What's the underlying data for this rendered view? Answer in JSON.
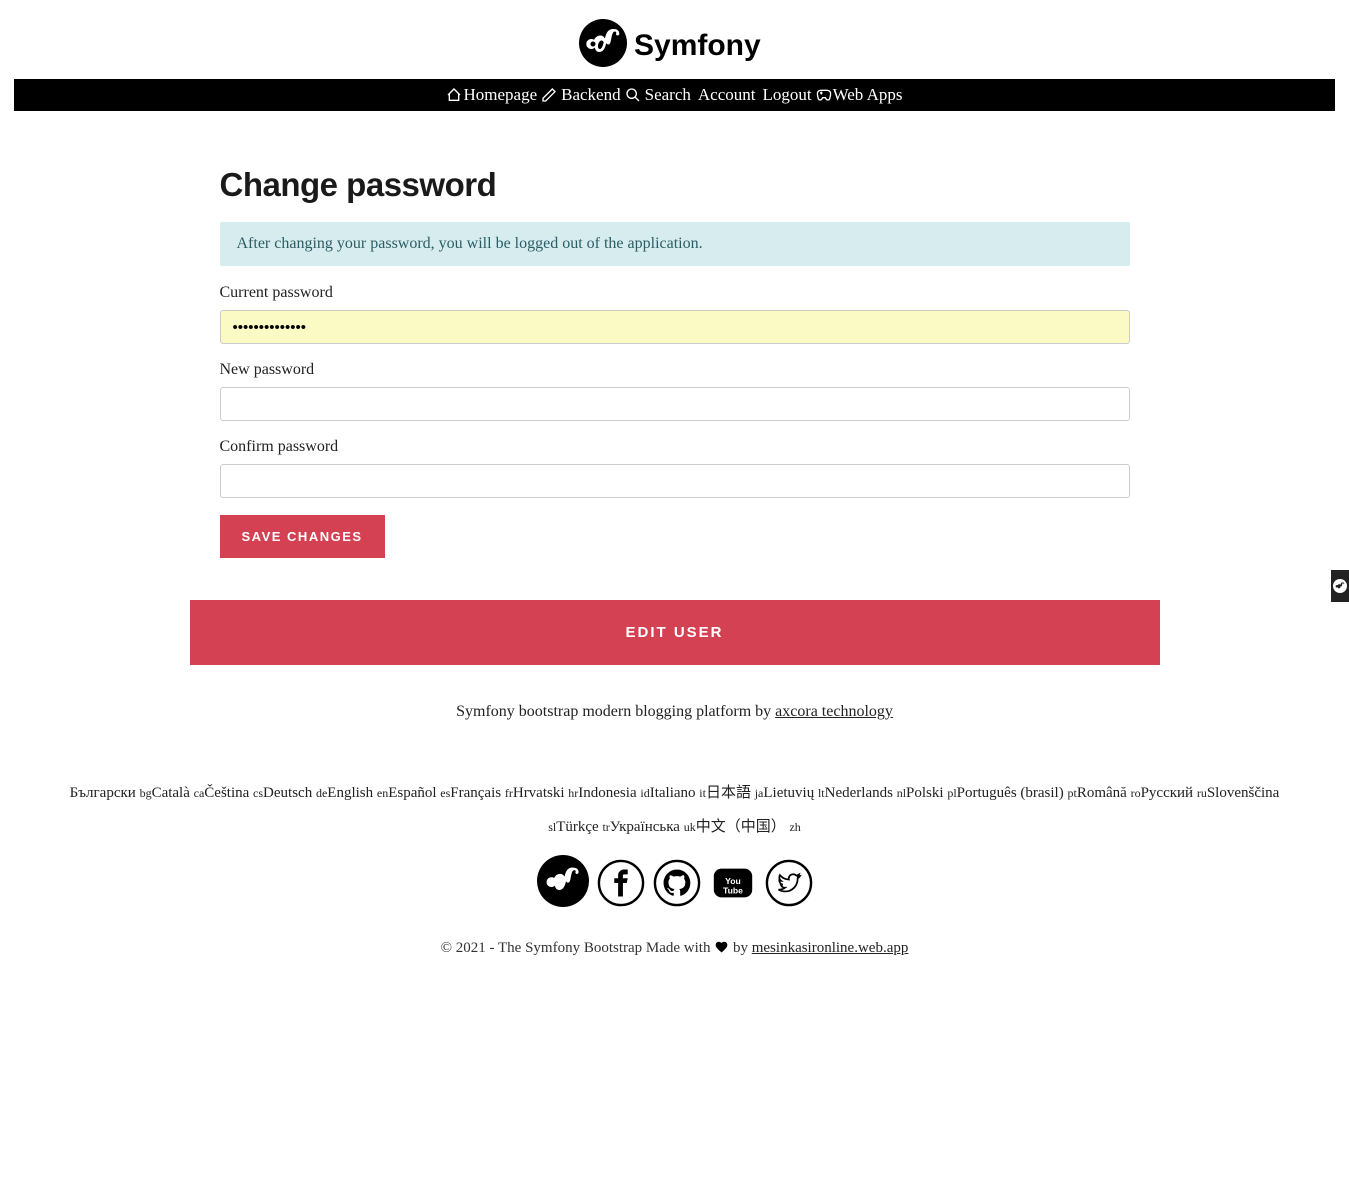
{
  "header": {
    "brand": "Symfony",
    "nav": [
      {
        "label": "Homepage",
        "name": "nav-homepage",
        "icon": "home-icon"
      },
      {
        "label": "Backend",
        "name": "nav-backend",
        "icon": "pencil-icon"
      },
      {
        "label": "Search",
        "name": "nav-search",
        "icon": "search-icon"
      },
      {
        "label": "Account",
        "name": "nav-account",
        "icon": null
      },
      {
        "label": "Logout",
        "name": "nav-logout",
        "icon": null
      },
      {
        "label": "Web Apps",
        "name": "nav-webapps",
        "icon": "gamepad-icon"
      }
    ]
  },
  "page": {
    "title": "Change password",
    "alert": "After changing your password, you will be logged out of the application.",
    "labels": {
      "current": "Current password",
      "new": "New password",
      "confirm": "Confirm password"
    },
    "current_value_mask": "••••••••••••••",
    "submit_label": "SAVE CHANGES",
    "edit_user_label": "EDIT USER"
  },
  "footer": {
    "tagline_prefix": "Symfony bootstrap modern blogging platform by ",
    "tagline_link": "axcora technology",
    "locales": [
      {
        "label": "Български",
        "code": "bg"
      },
      {
        "label": "Català",
        "code": "ca"
      },
      {
        "label": "Čeština",
        "code": "cs"
      },
      {
        "label": "Deutsch",
        "code": "de"
      },
      {
        "label": "English",
        "code": "en"
      },
      {
        "label": "Español",
        "code": "es"
      },
      {
        "label": "Français",
        "code": "fr"
      },
      {
        "label": "Hrvatski",
        "code": "hr"
      },
      {
        "label": "Indonesia",
        "code": "id"
      },
      {
        "label": "Italiano",
        "code": "it"
      },
      {
        "label": "日本語",
        "code": "ja"
      },
      {
        "label": "Lietuvių",
        "code": "lt"
      },
      {
        "label": "Nederlands",
        "code": "nl"
      },
      {
        "label": "Polski",
        "code": "pl"
      },
      {
        "label": "Português (brasil)",
        "code": "pt"
      },
      {
        "label": "Română",
        "code": "ro"
      },
      {
        "label": "Русский",
        "code": "ru"
      },
      {
        "label": "Slovenščina",
        "code": "sl"
      },
      {
        "label": "Türkçe",
        "code": "tr"
      },
      {
        "label": "Українська",
        "code": "uk"
      },
      {
        "label": "中文（中国）",
        "code": "zh"
      }
    ],
    "copyright_prefix": "© 2021 - The Symfony Bootstrap Made with ",
    "copyright_mid": " by ",
    "copyright_link": "mesinkasironline.web.app"
  },
  "colors": {
    "accent": "#d44153",
    "info_bg": "#d7ecef",
    "info_text": "#2a5d63",
    "autofill": "#fbfac5"
  }
}
